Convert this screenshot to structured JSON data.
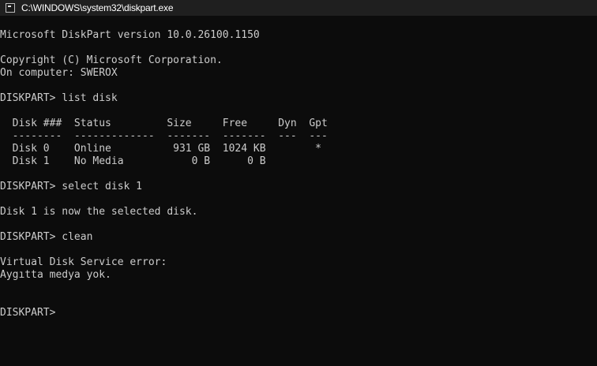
{
  "window": {
    "title": "C:\\WINDOWS\\system32\\diskpart.exe",
    "icon": "console-app-icon"
  },
  "console": {
    "lines": [
      "Microsoft DiskPart version 10.0.26100.1150",
      "",
      "Copyright (C) Microsoft Corporation.",
      "On computer: SWEROX",
      "",
      "DISKPART> list disk",
      "",
      "  Disk ###  Status         Size     Free     Dyn  Gpt",
      "  --------  -------------  -------  -------  ---  ---",
      "  Disk 0    Online          931 GB  1024 KB        *",
      "  Disk 1    No Media           0 B      0 B",
      "",
      "DISKPART> select disk 1",
      "",
      "Disk 1 is now the selected disk.",
      "",
      "DISKPART> clean",
      "",
      "Virtual Disk Service error:",
      "Aygıtta medya yok.",
      "",
      "",
      "DISKPART> "
    ]
  }
}
